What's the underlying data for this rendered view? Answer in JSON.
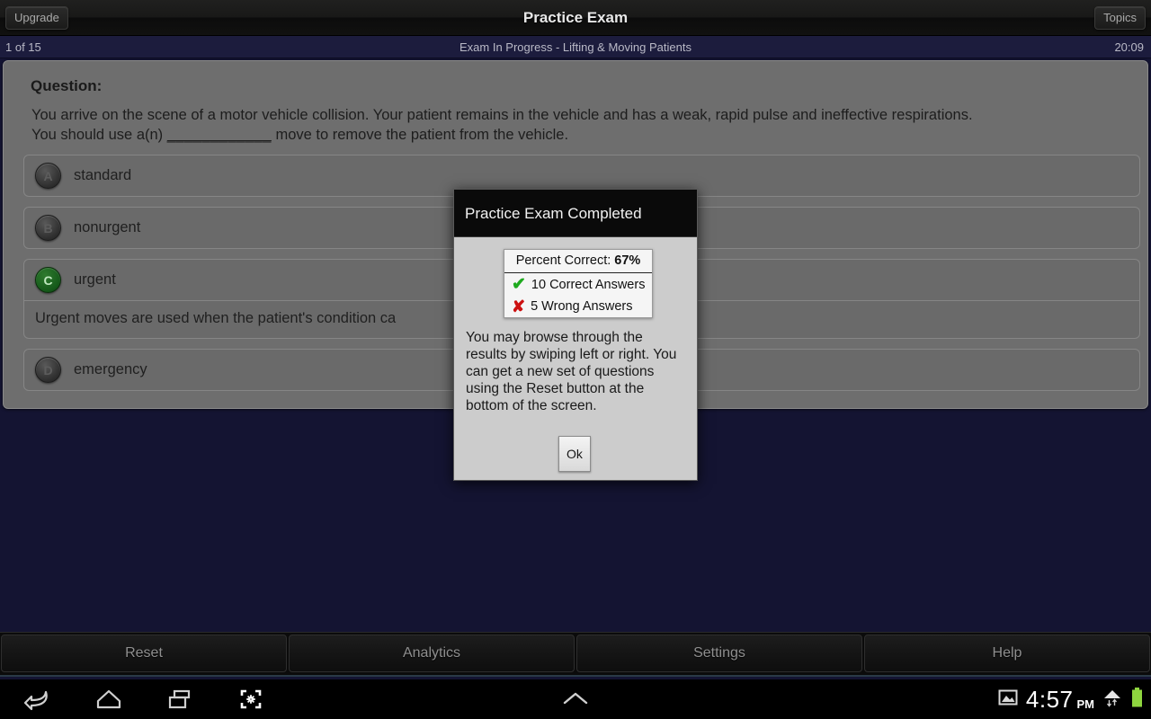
{
  "titlebar": {
    "upgrade_label": "Upgrade",
    "title": "Practice Exam",
    "topics_label": "Topics"
  },
  "substatus": {
    "progress": "1 of 15",
    "status": "Exam In Progress - Lifting & Moving Patients",
    "timer": "20:09"
  },
  "question": {
    "label": "Question:",
    "text_line1": "You arrive on the scene of a motor vehicle collision. Your patient remains in the vehicle and has a weak, rapid pulse and ineffective respirations.",
    "text_line2_before": "You should use a(n) ",
    "blank": "____________",
    "text_line2_after": " move to remove the patient from the vehicle.",
    "options": [
      {
        "letter": "A",
        "label": "standard",
        "correct": false,
        "explanation": ""
      },
      {
        "letter": "B",
        "label": "nonurgent",
        "correct": false,
        "explanation": ""
      },
      {
        "letter": "C",
        "label": "urgent",
        "correct": true,
        "explanation": "Urgent moves are used when the patient's condition ca"
      },
      {
        "letter": "D",
        "label": "emergency",
        "correct": false,
        "explanation": ""
      }
    ]
  },
  "dialog": {
    "title": "Practice Exam Completed",
    "percent_label": "Percent Correct: ",
    "percent_value": "67%",
    "correct_count": "10 Correct Answers",
    "wrong_count": "5 Wrong Answers",
    "tick_glyph": "✔",
    "cross_glyph": "✘",
    "body": "You may browse through the results by swiping left or right. You can get a new set of questions using the Reset button at the bottom of the screen.",
    "ok_label": "Ok"
  },
  "bottombar": {
    "buttons": [
      {
        "label": "Reset"
      },
      {
        "label": "Analytics"
      },
      {
        "label": "Settings"
      },
      {
        "label": "Help"
      }
    ]
  },
  "navbar": {
    "clock": "4:57",
    "ampm": "PM"
  },
  "colors": {
    "accent_navy": "#1c1c3d",
    "card_gray": "#6e6e6e",
    "correct_green": "#15591a",
    "battery_green": "#8fd63f"
  }
}
